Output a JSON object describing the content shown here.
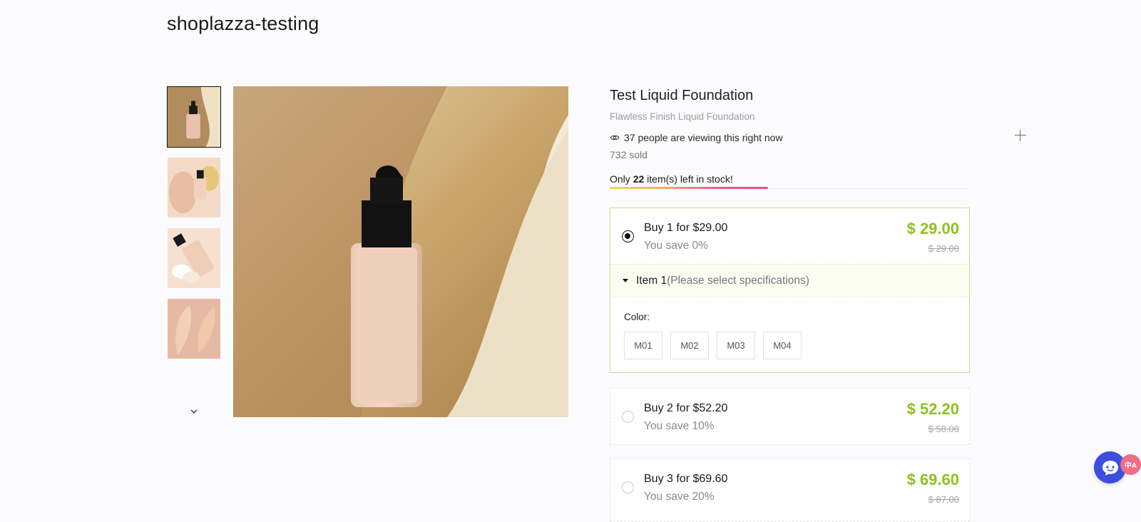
{
  "store": {
    "name": "shoplazza-testing"
  },
  "gallery": {
    "thumbnails": [
      "thumb-1",
      "thumb-2",
      "thumb-3",
      "thumb-4"
    ],
    "next_icon": "chevron-down-icon"
  },
  "product": {
    "title": "Test Liquid Foundation",
    "subtitle": "Flawless Finish Liquid Foundation",
    "viewing_text": "37 people are viewing this right now",
    "sold_text": "732 sold",
    "stock_prefix": "Only ",
    "stock_count": "22",
    "stock_suffix": " item(s) left in stock!",
    "stock_level_fraction": 0.44
  },
  "offers": [
    {
      "label": "Buy 1 for $29.00",
      "save": "You save 0%",
      "price": "$ 29.00",
      "original": "$ 29.00",
      "selected": true
    },
    {
      "label": "Buy 2 for $52.20",
      "save": "You save 10%",
      "price": "$ 52.20",
      "original": "$ 58.00",
      "selected": false
    },
    {
      "label": "Buy 3 for $69.60",
      "save": "You save 20%",
      "price": "$ 69.60",
      "original": "$ 87.00",
      "selected": false
    }
  ],
  "bundle_item": {
    "name": "Item 1",
    "hint": "(Please select specifications)",
    "spec_label": "Color:",
    "colors": [
      "M01",
      "M02",
      "M03",
      "M04"
    ]
  },
  "chat": {
    "badge_text": "中A"
  },
  "colors": {
    "price_green": "#8ec21f",
    "selected_border": "#c8e08f",
    "chat_blue": "#3b4ee0"
  }
}
